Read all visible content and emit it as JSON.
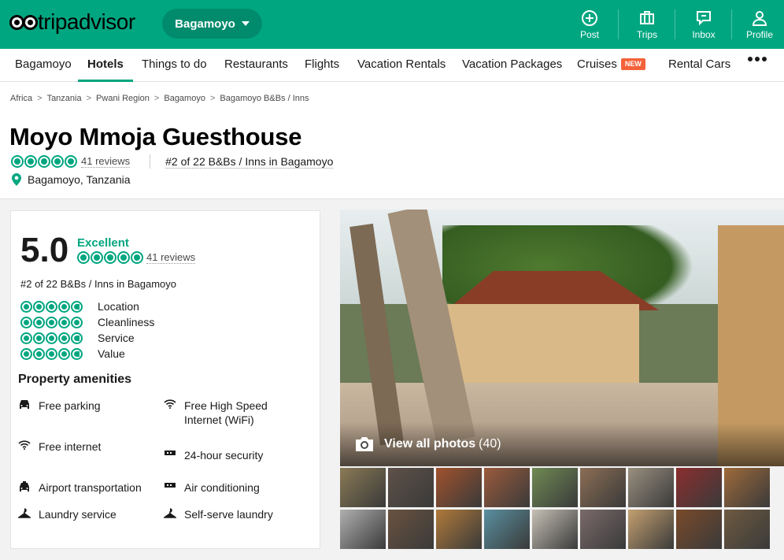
{
  "topbar": {
    "logo": "tripadvisor",
    "geo_label": "Bagamoyo",
    "actions": [
      {
        "label": "Post",
        "icon": "plus-circle-icon"
      },
      {
        "label": "Trips",
        "icon": "suitcase-icon"
      },
      {
        "label": "Inbox",
        "icon": "chat-bubble-icon"
      },
      {
        "label": "Profile",
        "icon": "person-icon"
      }
    ]
  },
  "nav": {
    "items": [
      "Bagamoyo",
      "Hotels",
      "Things to do",
      "Restaurants",
      "Flights",
      "Vacation Rentals",
      "Vacation Packages",
      "Cruises",
      "Rental Cars"
    ],
    "active": "Hotels",
    "cruises_badge": "NEW"
  },
  "breadcrumbs": [
    "Africa",
    "Tanzania",
    "Pwani Region",
    "Bagamoyo",
    "Bagamoyo B&Bs / Inns"
  ],
  "property": {
    "name": "Moyo Mmoja Guesthouse",
    "reviews": "41 reviews",
    "rating": 5,
    "rank": "#2 of 22 B&Bs / Inns in Bagamoyo",
    "location": "Bagamoyo, Tanzania"
  },
  "ratings_card": {
    "score": "5.0",
    "score_word": "Excellent",
    "reviews": "41 reviews",
    "rank": "#2 of 22 B&Bs / Inns in Bagamoyo",
    "subratings": [
      {
        "label": "Location",
        "value": 4.5
      },
      {
        "label": "Cleanliness",
        "value": 5
      },
      {
        "label": "Service",
        "value": 4.5
      },
      {
        "label": "Value",
        "value": 4.5
      }
    ],
    "amenities_title": "Property amenities",
    "amenities": [
      {
        "label": "Free parking",
        "icon": "car-icon"
      },
      {
        "label": "Free High Speed Internet (WiFi)",
        "icon": "wifi-icon"
      },
      {
        "label": "Free internet",
        "icon": "wifi-icon"
      },
      {
        "label": "24-hour security",
        "icon": "security-icon"
      },
      {
        "label": "Airport transportation",
        "icon": "taxi-icon"
      },
      {
        "label": "Air conditioning",
        "icon": "ac-icon"
      },
      {
        "label": "Laundry service",
        "icon": "hanger-icon"
      },
      {
        "label": "Self-serve laundry",
        "icon": "hanger-icon"
      }
    ]
  },
  "gallery": {
    "view_all": "View all photos",
    "count": "(40)",
    "thumb_colors": [
      "#8a7a55",
      "#5e5148",
      "#a0522d",
      "#9b5a3c",
      "#6f8a54",
      "#8c6e55",
      "#9a8f80",
      "#8b2e2e",
      "#9e6a3a",
      "#b0b0b0",
      "#6a5240",
      "#b07a3a",
      "#5a8fa0",
      "#c6c0b5",
      "#7a6a6a",
      "#c4a070",
      "#7a4a2a",
      "#6e5a40",
      "#8a8a80",
      "#a08060"
    ]
  }
}
